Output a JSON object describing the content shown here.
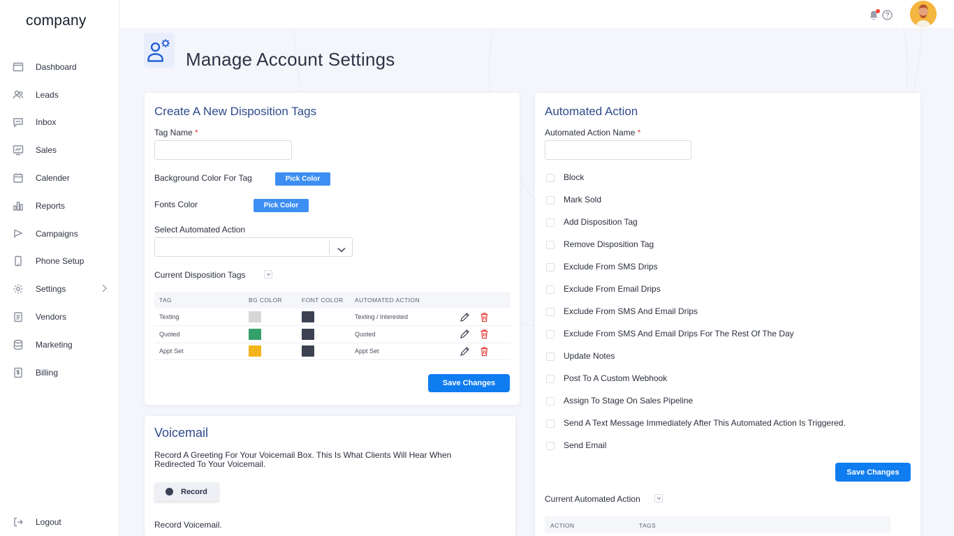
{
  "brand": {
    "logo_text": "company"
  },
  "sidebar": {
    "items": [
      {
        "label": "Dashboard",
        "icon": "dashboard-icon"
      },
      {
        "label": "Leads",
        "icon": "users-icon"
      },
      {
        "label": "Inbox",
        "icon": "chat-icon"
      },
      {
        "label": "Sales",
        "icon": "chart-icon"
      },
      {
        "label": "Calender",
        "icon": "calendar-icon"
      },
      {
        "label": "Reports",
        "icon": "bar-chart-icon"
      },
      {
        "label": "Campaigns",
        "icon": "flag-icon"
      },
      {
        "label": "Phone Setup",
        "icon": "phone-icon"
      },
      {
        "label": "Settings",
        "icon": "gear-icon"
      },
      {
        "label": "Vendors",
        "icon": "clipboard-icon"
      },
      {
        "label": "Marketing",
        "icon": "database-icon"
      },
      {
        "label": "Billing",
        "icon": "billing-icon"
      }
    ],
    "logout_label": "Logout"
  },
  "page": {
    "title": "Manage Account Settings"
  },
  "disposition": {
    "title": "Create A New Disposition Tags",
    "tag_name_label": "Tag Name",
    "required_mark": "*",
    "bg_color_label": "Background Color For Tag",
    "font_color_label": "Fonts Color",
    "pick_color_label": "Pick Color",
    "automated_action_label": "Select Automated Action",
    "current_tags_label": "Current Disposition Tags",
    "table": {
      "headers": [
        "TAG",
        "BG COLOR",
        "FONT COLOR",
        "AUTOMATED ACTION"
      ],
      "rows": [
        {
          "tag": "Texting",
          "bg": "#d6d6d6",
          "font": "#3c4252",
          "action": "Texting / Interested"
        },
        {
          "tag": "Quoted",
          "bg": "#34a06a",
          "font": "#3c4252",
          "action": "Quoted"
        },
        {
          "tag": "Appt Set",
          "bg": "#f3b41b",
          "font": "#3c4252",
          "action": "Appt Set"
        }
      ]
    },
    "save_label": "Save Changes"
  },
  "voicemail": {
    "title": "Voicemail",
    "description": "Record A Greeting For Your Voicemail Box. This Is What Clients Will Hear When Redirected To Your Voicemail.",
    "record_label": "Record",
    "record_voicemail_label": "Record Voicemail."
  },
  "automated": {
    "title": "Automated Action",
    "name_label": "Automated Action Name",
    "required_mark": "*",
    "options": [
      "Block",
      "Mark Sold",
      "Add Disposition Tag",
      "Remove Disposition Tag",
      "Exclude From SMS Drips",
      "Exclude From Email Drips",
      "Exclude From SMS And Email Drips",
      "Exclude From SMS And Email Drips For The Rest Of The Day",
      "Update Notes",
      "Post To A Custom Webhook",
      "Assign To Stage On Sales Pipeline",
      "Send A Text Message Immediately After This Automated Action Is Triggered.",
      "Send Email"
    ],
    "save_label": "Save Changes",
    "current_label": "Current Automated Action",
    "table_headers": [
      "ACTION",
      "TAGS"
    ]
  },
  "colors": {
    "accent": "#0f7cf0",
    "title_blue": "#2f4a8a",
    "danger": "#e53935"
  }
}
